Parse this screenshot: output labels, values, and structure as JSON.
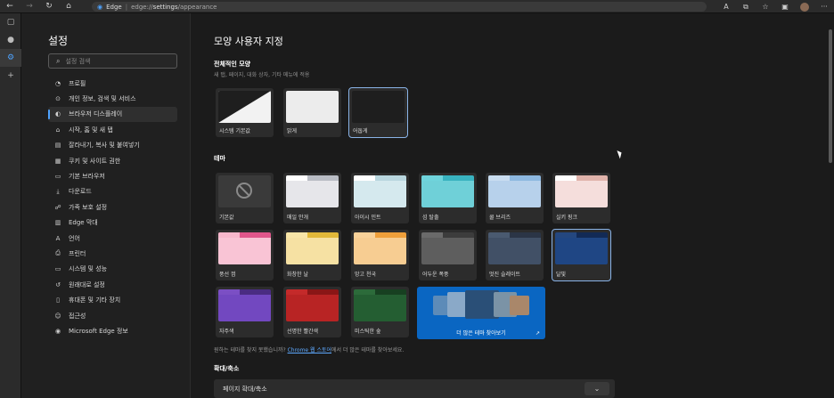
{
  "browser": {
    "site_name": "Edge",
    "url_scheme_host": "edge://",
    "url_path_bold": "settings",
    "url_path_rest": "/appearance"
  },
  "sidebar": {
    "title": "설정",
    "search_placeholder": "설정 검색",
    "items": [
      {
        "label": "프로필",
        "icon": "person-icon"
      },
      {
        "label": "개인 정보, 검색 및 서비스",
        "icon": "lock-icon"
      },
      {
        "label": "브라우저 디스플레이",
        "icon": "palette-icon",
        "active": true
      },
      {
        "label": "시작, 홈 및 새 탭",
        "icon": "home-icon"
      },
      {
        "label": "잘라내기, 복사 및 붙여넣기",
        "icon": "clipboard-icon"
      },
      {
        "label": "쿠키 및 사이트 권한",
        "icon": "cookie-icon"
      },
      {
        "label": "기본 브라우저",
        "icon": "browser-icon"
      },
      {
        "label": "다운로드",
        "icon": "download-icon"
      },
      {
        "label": "가족 보호 설정",
        "icon": "family-icon"
      },
      {
        "label": "Edge 막대",
        "icon": "edge-bar-icon"
      },
      {
        "label": "언어",
        "icon": "language-icon"
      },
      {
        "label": "프린터",
        "icon": "printer-icon"
      },
      {
        "label": "시스템 및 성능",
        "icon": "system-icon"
      },
      {
        "label": "원래대로 설정",
        "icon": "reset-icon"
      },
      {
        "label": "휴대폰 및 기타 장치",
        "icon": "phone-icon"
      },
      {
        "label": "접근성",
        "icon": "accessibility-icon"
      },
      {
        "label": "Microsoft Edge 정보",
        "icon": "edge-icon"
      }
    ]
  },
  "main": {
    "page_title": "모양 사용자 지정",
    "overall": {
      "title": "전체적인 모양",
      "subtitle": "새 탭, 페이지, 대화 상자, 기타 메뉴에 적용",
      "options": [
        {
          "label": "시스템 기본값",
          "selected": false
        },
        {
          "label": "밝게",
          "selected": false
        },
        {
          "label": "어둡게",
          "selected": true
        }
      ]
    },
    "theme": {
      "title": "테마",
      "items": [
        {
          "label": "기본값",
          "tab": "#3a3a3a",
          "bar": "#3a3a3a",
          "body": "#3a3a3a",
          "selected": false
        },
        {
          "label": "매일 안개",
          "tab": "#ffffff",
          "bar": "#b9bcc4",
          "body": "#e6e6ea",
          "selected": false
        },
        {
          "label": "아이시 민트",
          "tab": "#ffffff",
          "bar": "#b9d6de",
          "body": "#d5e9ee",
          "selected": false
        },
        {
          "label": "섬 탈출",
          "tab": "#6fd4dc",
          "bar": "#39b3c0",
          "body": "#6fd0d8",
          "selected": false
        },
        {
          "label": "쿨 브리즈",
          "tab": "#c9ddf0",
          "bar": "#8db8e0",
          "body": "#b7d1eb",
          "selected": false
        },
        {
          "label": "실키 핑크",
          "tab": "#ffffff",
          "bar": "#e0b3ab",
          "body": "#f5dedc",
          "selected": false
        },
        {
          "label": "풍선 껌",
          "tab": "#f7b8cc",
          "bar": "#e1568b",
          "body": "#f9c4d5",
          "selected": false
        },
        {
          "label": "화창한 날",
          "tab": "#f8e5a8",
          "bar": "#e2b839",
          "body": "#f6e1a3",
          "selected": false
        },
        {
          "label": "망고 천국",
          "tab": "#f9d29a",
          "bar": "#ef9f3a",
          "body": "#f7cd92",
          "selected": false
        },
        {
          "label": "어두운 폭풍",
          "tab": "#6a6a6a",
          "bar": "#3c3c3c",
          "body": "#5e5e5e",
          "selected": false
        },
        {
          "label": "멋진 슬레이트",
          "tab": "#4a5a70",
          "bar": "#2b3546",
          "body": "#415066",
          "selected": false
        },
        {
          "label": "달빛",
          "tab": "#24477f",
          "bar": "#122a55",
          "body": "#1f4684",
          "selected": true
        },
        {
          "label": "자주색",
          "tab": "#7b4fc4",
          "bar": "#4a2c82",
          "body": "#7248c0",
          "selected": false
        },
        {
          "label": "선명한 빨간색",
          "tab": "#c42a2a",
          "bar": "#8a1616",
          "body": "#b82424",
          "selected": false
        },
        {
          "label": "미스틱한 숲",
          "tab": "#2c6b3a",
          "bar": "#174021",
          "body": "#245e32",
          "selected": false
        }
      ],
      "more_themes_label": "더 많은 테마 찾아보기",
      "note_before": "원하는 테마를 찾지 못했습니까? ",
      "note_link": "Chrome 웹 스토어",
      "note_after": "에서 더 많은 테마를 찾아보세요."
    },
    "zoom": {
      "title": "확대/축소",
      "row_label": "페이지 확대/축소"
    }
  }
}
